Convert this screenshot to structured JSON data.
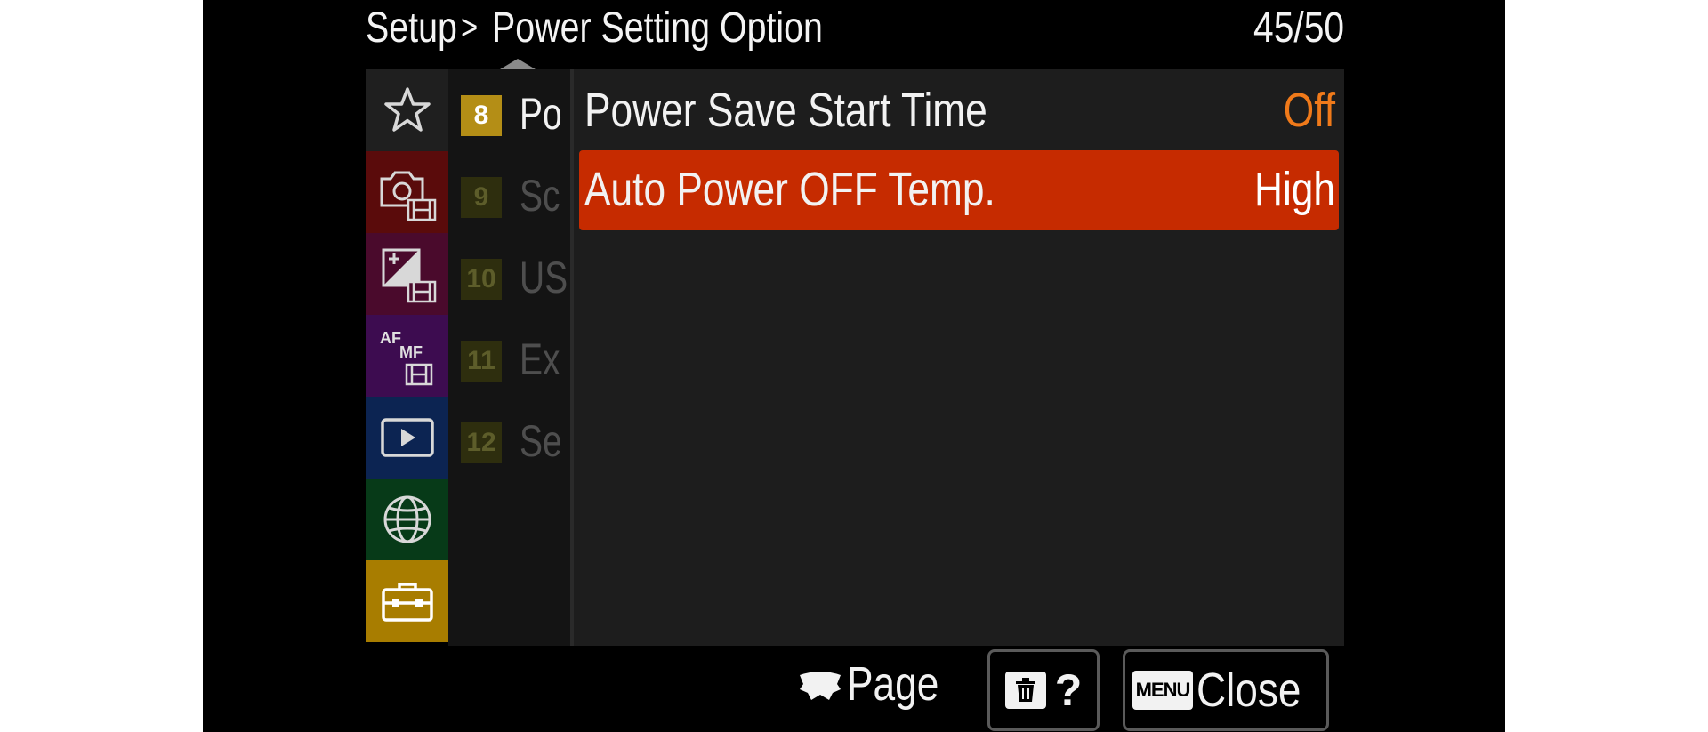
{
  "header": {
    "breadcrumb_root": "Setup",
    "breadcrumb_separator": ">",
    "breadcrumb_current": "Power Setting Option",
    "page_counter": "45/50"
  },
  "tabs": [
    {
      "id": "tab-favorites",
      "icon": "star-icon",
      "color": "#1f1f1f"
    },
    {
      "id": "tab-shooting",
      "icon": "camera-movie-icon",
      "color": "#5a0b0b"
    },
    {
      "id": "tab-exposure-color",
      "icon": "exposure-movie-icon",
      "color": "#4a0a2c"
    },
    {
      "id": "tab-focus",
      "icon": "af-mf-movie-icon",
      "color": "#3d0c50"
    },
    {
      "id": "tab-playback",
      "icon": "play-icon",
      "color": "#0c2452"
    },
    {
      "id": "tab-network",
      "icon": "globe-icon",
      "color": "#073a18"
    },
    {
      "id": "tab-setup",
      "icon": "toolbox-icon",
      "color": "#a87d00",
      "selected": true
    }
  ],
  "groups": [
    {
      "num": "8",
      "label": "Po",
      "active": true
    },
    {
      "num": "9",
      "label": "Sc",
      "active": false
    },
    {
      "num": "10",
      "label": "US",
      "active": false
    },
    {
      "num": "11",
      "label": "Ex",
      "active": false
    },
    {
      "num": "12",
      "label": "Se",
      "active": false
    }
  ],
  "items": [
    {
      "label": "Power Save Start Time",
      "value": "Off",
      "selected": false
    },
    {
      "label": "Auto Power OFF Temp.",
      "value": "High",
      "selected": true
    }
  ],
  "footer": {
    "page_label": "Page",
    "help_label": "?",
    "menu_key": "MENU",
    "close_label": "Close"
  },
  "colors": {
    "selected_row": "#c62b00",
    "value_accent": "#f07a1a",
    "active_group": "#b48e16"
  }
}
